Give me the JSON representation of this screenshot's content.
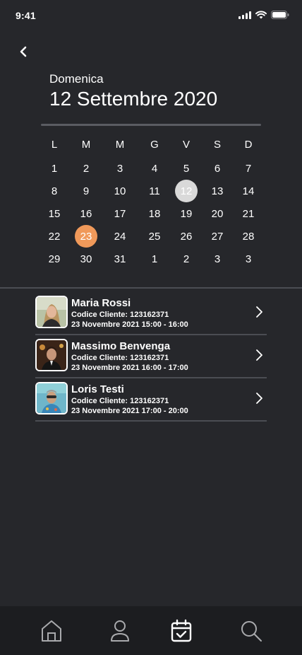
{
  "status_bar": {
    "time": "9:41"
  },
  "header": {
    "weekday": "Domenica",
    "date": "12 Settembre 2020"
  },
  "calendar": {
    "day_headers": [
      "L",
      "M",
      "M",
      "G",
      "V",
      "S",
      "D"
    ],
    "weeks": [
      [
        "1",
        "2",
        "3",
        "4",
        "5",
        "6",
        "7"
      ],
      [
        "8",
        "9",
        "10",
        "11",
        "12",
        "13",
        "14"
      ],
      [
        "15",
        "16",
        "17",
        "18",
        "19",
        "20",
        "21"
      ],
      [
        "22",
        "23",
        "24",
        "25",
        "26",
        "27",
        "28"
      ],
      [
        "29",
        "30",
        "31",
        "1",
        "2",
        "3",
        "3"
      ]
    ],
    "selected_day": "12",
    "today_day": "23",
    "selected_color": "#d9d9d9",
    "today_color": "#f0995a"
  },
  "appointments": [
    {
      "name": "Maria Rossi",
      "code": "Codice Cliente: 123162371",
      "time": "23 Novembre 2021 15:00 - 16:00"
    },
    {
      "name": "Massimo Benvenga",
      "code": "Codice Cliente: 123162371",
      "time": "23 Novembre 2021 16:00 - 17:00"
    },
    {
      "name": "Loris Testi",
      "code": "Codice Cliente: 123162371",
      "time": "23 Novembre 2021 17:00 - 20:00"
    }
  ],
  "tab_bar": {
    "tabs": [
      {
        "icon": "home-icon",
        "active": false
      },
      {
        "icon": "user-icon",
        "active": false
      },
      {
        "icon": "calendar-check-icon",
        "active": true
      },
      {
        "icon": "search-icon",
        "active": false
      }
    ]
  }
}
